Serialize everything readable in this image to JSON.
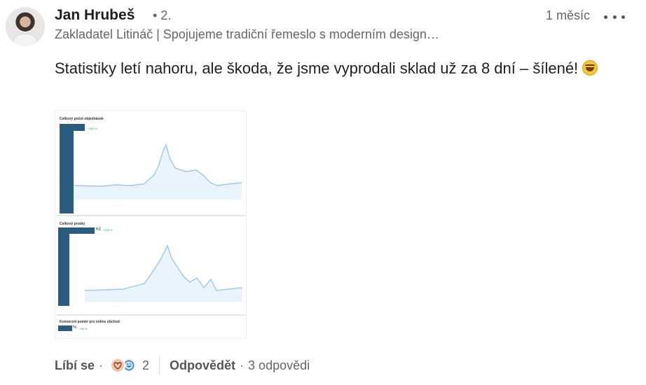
{
  "author": {
    "name": "Jan Hrubeš",
    "degree": "• 2.",
    "headline": "Zakladatel Litináč | Spojujeme tradiční řemeslo s moderním design…",
    "avatar_icon": "profile-photo"
  },
  "meta": {
    "time": "1 měsíc",
    "more_icon": "ellipsis-icon"
  },
  "comment": {
    "text": "Statistiky letí nahoru, ale škoda, že jsme vyprodali sklad už za 8 dní – šílené!",
    "emoji": "tears-of-joy-emoji"
  },
  "attachment": {
    "panels": [
      {
        "title": "Celkový počet objednávek",
        "pct": "+166 %"
      },
      {
        "title": "Celkový prodej",
        "value_suffix": "Kč",
        "pct": "+168 %"
      },
      {
        "title": "Konverzní poměr pro online obchod",
        "value_suffix": "%",
        "pct": "+98 %"
      }
    ],
    "chart_color": "#9ec9ea",
    "bar_color": "#2a5c80"
  },
  "footer": {
    "like_label": "Líbí se",
    "separator": "·",
    "reaction_count": "2",
    "reply_label": "Odpovědět",
    "replies": "3 odpovědi"
  }
}
